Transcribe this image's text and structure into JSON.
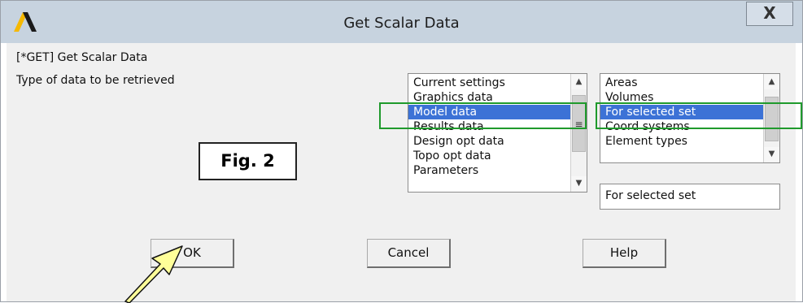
{
  "window": {
    "title": "Get Scalar Data",
    "close_label": "X"
  },
  "dialog": {
    "command_label": "[*GET]  Get Scalar Data",
    "type_label": "Type of data to be retrieved"
  },
  "left_list": {
    "items": [
      {
        "label": "Current settings",
        "selected": false
      },
      {
        "label": "Graphics data",
        "selected": false
      },
      {
        "label": "Model data",
        "selected": true
      },
      {
        "label": "Results data",
        "selected": false
      },
      {
        "label": "Design opt data",
        "selected": false
      },
      {
        "label": "Topo opt data",
        "selected": false
      },
      {
        "label": "Parameters",
        "selected": false
      }
    ]
  },
  "right_list": {
    "items": [
      {
        "label": "Areas",
        "selected": false
      },
      {
        "label": "Volumes",
        "selected": false
      },
      {
        "label": "For selected set",
        "selected": true
      },
      {
        "label": "Coord systems",
        "selected": false
      },
      {
        "label": "Element types",
        "selected": false
      }
    ]
  },
  "readout_value": "For selected set",
  "buttons": {
    "ok": "OK",
    "cancel": "Cancel",
    "help": "Help"
  },
  "annotation": {
    "fig_label": "Fig. 2",
    "highlight_color": "#1f9a2c",
    "arrow_color": "#ffff99"
  },
  "colors": {
    "titlebar": "#c7d3df",
    "selection": "#3c72d6"
  },
  "icons": {
    "logo": "ansys-logo-icon",
    "scroll_up": "chevron-up-icon",
    "scroll_down": "chevron-down-icon"
  }
}
